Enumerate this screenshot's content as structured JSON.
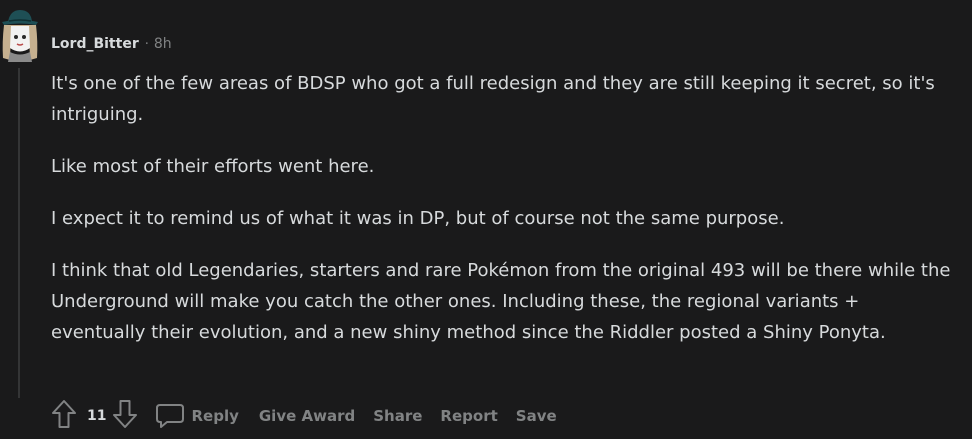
{
  "comment": {
    "author": "Lord_Bitter",
    "separator": "·",
    "time": "8h",
    "paragraphs": [
      "It's one of the few areas of BDSP who got a full redesign and they are still keeping it secret, so it's intriguing.",
      "Like most of their efforts went here.",
      "I expect it to remind us of what it was in DP, but of course not the same purpose.",
      "I think that old Legendaries, starters and rare Pokémon from the original 493 will be there while the Underground will make you catch the other ones. Including these, the regional variants + eventually their evolution, and a new shiny method since the Riddler posted a Shiny Ponyta."
    ],
    "votes": "11",
    "actions": {
      "reply": "Reply",
      "give_award": "Give Award",
      "share": "Share",
      "report": "Report",
      "save": "Save"
    }
  },
  "colors": {
    "background": "#1a1a1b",
    "text": "#d7dadc",
    "muted": "#818384",
    "thread_line": "#343536"
  },
  "icons": {
    "avatar": "user-avatar",
    "upvote": "upvote-arrow-icon",
    "downvote": "downvote-arrow-icon",
    "reply": "speech-bubble-icon"
  }
}
